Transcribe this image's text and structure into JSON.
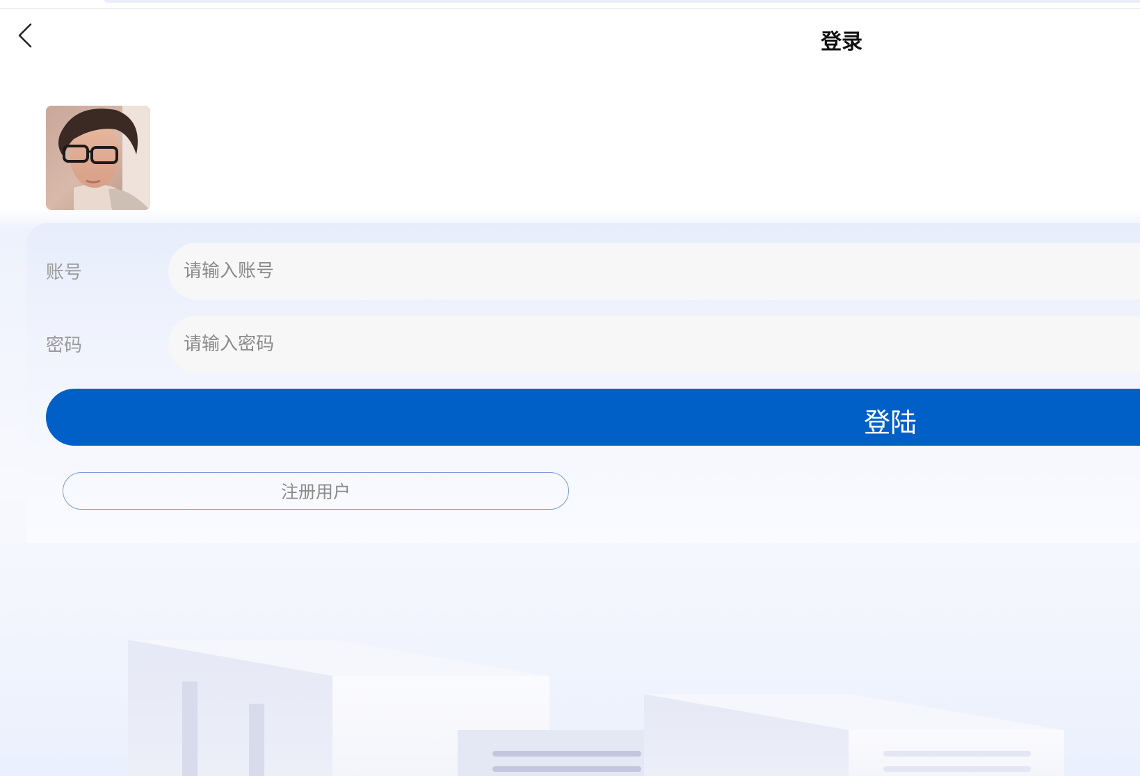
{
  "header": {
    "title": "登录",
    "back_icon": "chevron-left-icon"
  },
  "avatar": {
    "description_icon": "user-avatar"
  },
  "form": {
    "account_label": "账号",
    "account_placeholder": "请输入账号",
    "password_label": "密码",
    "password_placeholder": "请输入密码",
    "login_label": "登陆",
    "register_label": "注册用户"
  },
  "colors": {
    "primary": "#0060c8",
    "input_bg": "#f7f7f7",
    "label": "#9a9a9a"
  }
}
